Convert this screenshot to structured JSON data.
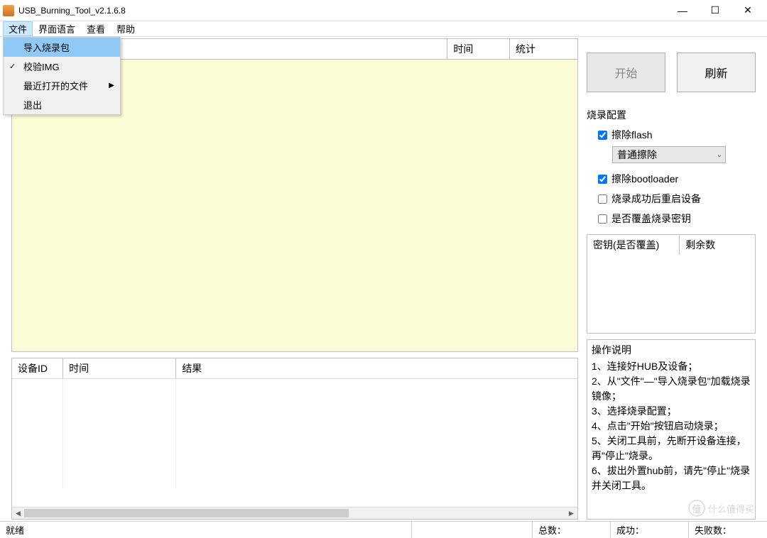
{
  "window": {
    "title": "USB_Burning_Tool_v2.1.6.8"
  },
  "menu": {
    "items": [
      "文件",
      "界面语言",
      "查看",
      "帮助"
    ],
    "file_dropdown": {
      "import": "导入烧录包",
      "verify": "校验IMG",
      "recent": "最近打开的文件",
      "exit": "退出"
    }
  },
  "top_table": {
    "col_time": "时间",
    "col_stats": "统计"
  },
  "bottom_table": {
    "col_device_id": "设备ID",
    "col_time": "时间",
    "col_result": "结果"
  },
  "buttons": {
    "start": "开始",
    "refresh": "刷新"
  },
  "config": {
    "title": "烧录配置",
    "erase_flash": "擦除flash",
    "erase_mode": "普通擦除",
    "erase_bootloader": "擦除bootloader",
    "reboot_after": "烧录成功后重启设备",
    "overwrite_key": "是否覆盖烧录密钥"
  },
  "key_table": {
    "col_key": "密钥(是否覆盖)",
    "col_remaining": "剩余数"
  },
  "instructions": {
    "title": "操作说明",
    "step1": "1、连接好HUB及设备；",
    "step2": "2、从\"文件\"—\"导入烧录包\"加载烧录镜像；",
    "step3": "3、选择烧录配置；",
    "step4": "4、点击\"开始\"按钮启动烧录；",
    "step5": "5、关闭工具前，先断开设备连接，再\"停止\"烧录。",
    "step6": "6、拔出外置hub前，请先\"停止\"烧录并关闭工具。"
  },
  "statusbar": {
    "ready": "就绪",
    "total": "总数：",
    "success": "成功：",
    "failed": "失败数："
  },
  "watermark": "什么值得买"
}
